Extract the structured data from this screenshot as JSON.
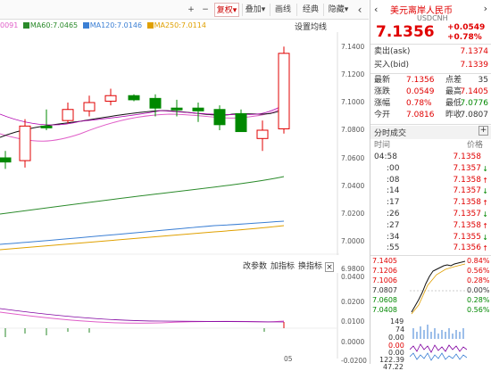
{
  "toolbar": {
    "plus": "+",
    "minus": "−",
    "fq": "复权",
    "overlay": "叠加",
    "draw": "画线",
    "classic": "经典",
    "hide": "隐藏",
    "arrow": "‹",
    "settings_label": "设置均线"
  },
  "ma_legend": {
    "ma_first": "0091",
    "ma60": "MA60:7.0465",
    "ma120": "MA120:7.0146",
    "ma250": "MA250:7.0114"
  },
  "y_axis": [
    "7.1400",
    "7.1200",
    "7.1000",
    "7.0800",
    "7.0600",
    "7.0400",
    "7.0200",
    "7.0000",
    "6.9800"
  ],
  "sub_axis": [
    "0.0400",
    "0.0200",
    "0.0100",
    "0.0000",
    "-0.0200"
  ],
  "x_axis_label": "05",
  "sub_buttons": {
    "params": "改参数",
    "add": "加指标",
    "change": "换指标",
    "close": "×"
  },
  "quote": {
    "name": "美元离岸人民币",
    "code": "USDCNH",
    "price": "7.1356",
    "change": "+0.0549",
    "change_pct": "+0.78%",
    "ask_label": "卖出(ask)",
    "ask": "7.1374",
    "bid_label": "买入(bid)",
    "bid": "7.1339",
    "latest_label": "最新",
    "latest": "7.1356",
    "points_label": "点差",
    "points": "35",
    "chg_label": "涨跌",
    "chg": "0.0549",
    "high_label": "最高",
    "high": "7.1405",
    "amp_label": "涨幅",
    "amp": "0.78%",
    "low_label": "最低",
    "low": "7.0776",
    "open_label": "今开",
    "open": "7.0816",
    "prev_label": "昨收",
    "prev": "7.0807"
  },
  "trades_header": {
    "title": "分时成交",
    "time": "时间",
    "price": "价格"
  },
  "trades": [
    {
      "time": "04:58",
      "price": "7.1358",
      "dir": ""
    },
    {
      "time": ":00",
      "price": "7.1357",
      "dir": "down"
    },
    {
      "time": ":08",
      "price": "7.1358",
      "dir": "up"
    },
    {
      "time": ":14",
      "price": "7.1357",
      "dir": "down"
    },
    {
      "time": ":17",
      "price": "7.1358",
      "dir": "up"
    },
    {
      "time": ":26",
      "price": "7.1357",
      "dir": "down"
    },
    {
      "time": ":27",
      "price": "7.1358",
      "dir": "up"
    },
    {
      "time": ":34",
      "price": "7.1355",
      "dir": "down"
    },
    {
      "time": ":55",
      "price": "7.1356",
      "dir": "up"
    }
  ],
  "mini_chart": {
    "left_prices": [
      "7.1405",
      "7.1206",
      "7.1006",
      "7.0807",
      "7.0608",
      "7.0408"
    ],
    "right_pcts": [
      "0.84%",
      "0.56%",
      "0.28%",
      "0.00%",
      "0.28%",
      "0.56%"
    ],
    "vol_labels": [
      "149",
      "74",
      "0.00"
    ],
    "ind_labels": [
      "0.00",
      "0.00",
      "122.39",
      "47.22"
    ]
  },
  "colors": {
    "up": "#e00000",
    "down": "#008800",
    "ma60": "#2a8a2a",
    "ma120": "#3b7fd4",
    "ma250": "#e0a000",
    "ma_pink": "#e05ec8",
    "ma_black": "#111111"
  },
  "candles": [
    {
      "o": 7.06,
      "h": 7.065,
      "l": 7.052,
      "c": 7.057,
      "dir": "down"
    },
    {
      "o": 7.058,
      "h": 7.088,
      "l": 7.053,
      "c": 7.083,
      "dir": "up"
    },
    {
      "o": 7.083,
      "h": 7.095,
      "l": 7.08,
      "c": 7.082,
      "dir": "down"
    },
    {
      "o": 7.087,
      "h": 7.1,
      "l": 7.085,
      "c": 7.095,
      "dir": "up"
    },
    {
      "o": 7.094,
      "h": 7.105,
      "l": 7.09,
      "c": 7.1,
      "dir": "up"
    },
    {
      "o": 7.101,
      "h": 7.11,
      "l": 7.098,
      "c": 7.105,
      "dir": "up"
    },
    {
      "o": 7.105,
      "h": 7.106,
      "l": 7.101,
      "c": 7.102,
      "dir": "down"
    },
    {
      "o": 7.103,
      "h": 7.106,
      "l": 7.09,
      "c": 7.096,
      "dir": "down"
    },
    {
      "o": 7.096,
      "h": 7.102,
      "l": 7.09,
      "c": 7.095,
      "dir": "down"
    },
    {
      "o": 7.096,
      "h": 7.1,
      "l": 7.086,
      "c": 7.094,
      "dir": "down"
    },
    {
      "o": 7.095,
      "h": 7.098,
      "l": 7.08,
      "c": 7.084,
      "dir": "down"
    },
    {
      "o": 7.092,
      "h": 7.095,
      "l": 7.086,
      "c": 7.079,
      "dir": "down"
    },
    {
      "o": 7.08,
      "h": 7.087,
      "l": 7.065,
      "c": 7.074,
      "dir": "up"
    },
    {
      "o": 7.081,
      "h": 7.1405,
      "l": 7.0776,
      "c": 7.1356,
      "dir": "up"
    }
  ]
}
